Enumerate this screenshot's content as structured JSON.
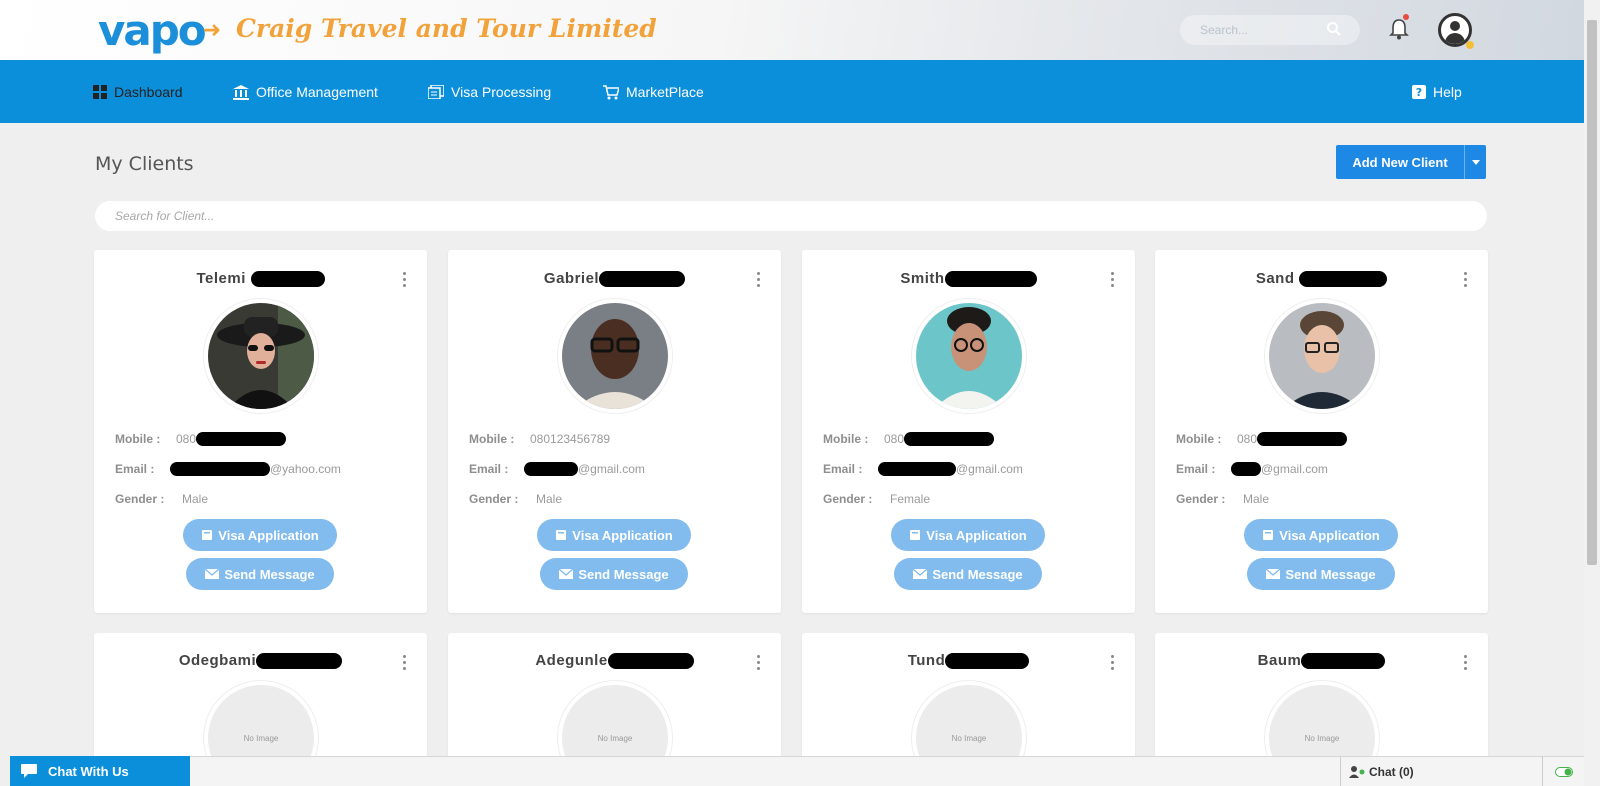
{
  "header": {
    "logo_text": "vapo",
    "company_name": "Craig Travel and Tour Limited",
    "search_placeholder": "Search..."
  },
  "nav": {
    "items": [
      {
        "label": "Dashboard",
        "icon": "dashboard-icon"
      },
      {
        "label": "Office Management",
        "icon": "bank-icon"
      },
      {
        "label": "Visa Processing",
        "icon": "documents-icon"
      },
      {
        "label": "MarketPlace",
        "icon": "cart-icon"
      }
    ],
    "help_label": "Help"
  },
  "page": {
    "title": "My Clients",
    "add_button_label": "Add New Client",
    "client_search_placeholder": "Search for Client..."
  },
  "labels": {
    "mobile": "Mobile :",
    "email": "Email :",
    "gender": "Gender :",
    "visa_button": "Visa Application",
    "message_button": "Send Message",
    "no_image": "No Image"
  },
  "clients": [
    {
      "name": "Telemi",
      "mobile": "080",
      "email_domain": "@yahoo.com",
      "gender": "Male"
    },
    {
      "name": "Gabriel",
      "mobile": "080123456789",
      "email_domain": "@gmail.com",
      "gender": "Male"
    },
    {
      "name": "Smith",
      "mobile": "080",
      "email_domain": "@gmail.com",
      "gender": "Female"
    },
    {
      "name": "Sand",
      "mobile": "080",
      "email_domain": "@gmail.com",
      "gender": "Male"
    },
    {
      "name": "Odegbami"
    },
    {
      "name": "Adegunle"
    },
    {
      "name": "Tund"
    },
    {
      "name": "Baum"
    }
  ],
  "chat": {
    "widget_label": "Chat With Us",
    "chat_label": "Chat",
    "chat_count": "(0)"
  },
  "colors": {
    "brand_blue": "#0c8fda",
    "accent_orange": "#f2a23a",
    "button_blue": "#1e88e5",
    "pill_blue": "#82bcef"
  }
}
